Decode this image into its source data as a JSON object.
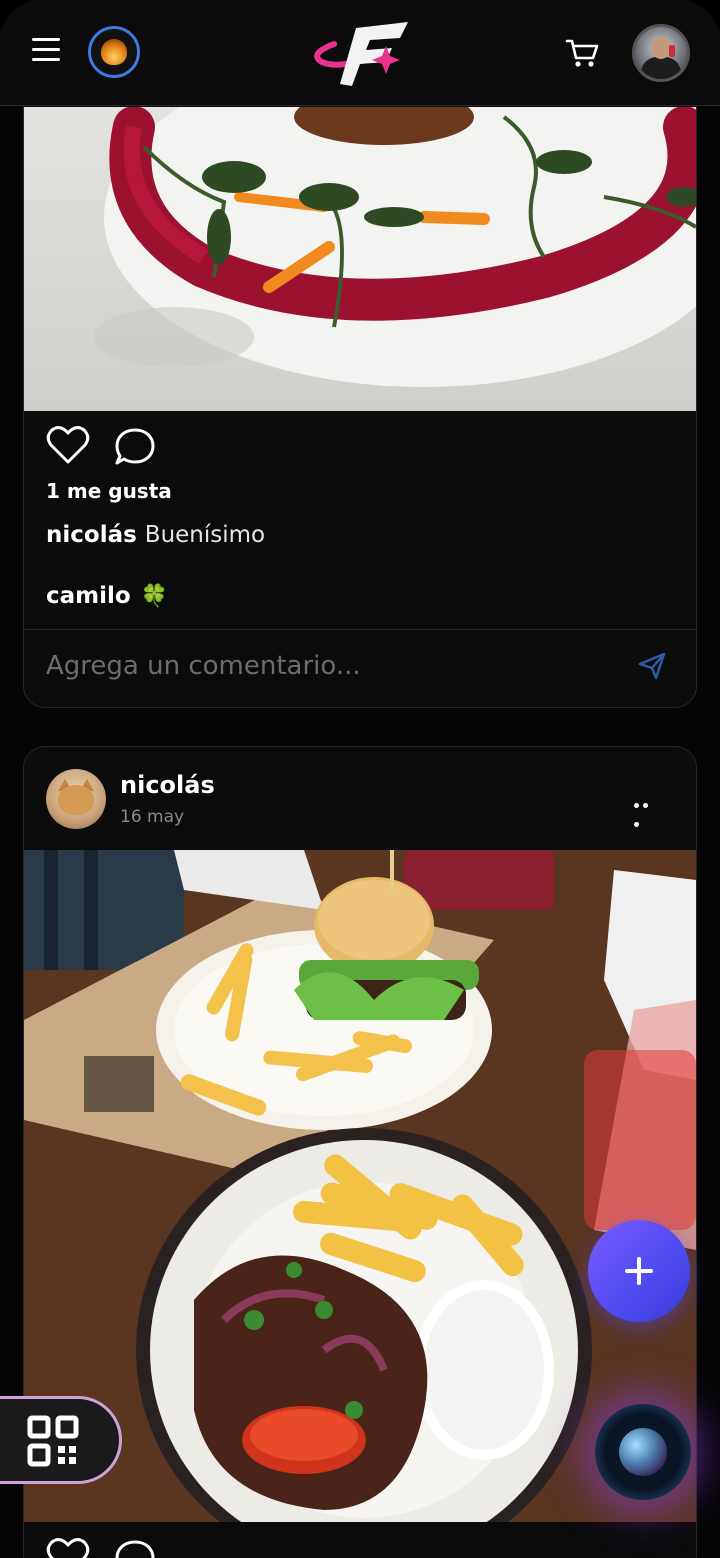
{
  "header": {
    "menu_icon": "hamburger-menu-icon",
    "cart_icon": "shopping-cart-icon",
    "logo_icon": "app-logo"
  },
  "post1": {
    "likes_text": "1 me gusta",
    "comments": [
      {
        "user": "nicolás",
        "text": "Buenísimo"
      },
      {
        "user": "camilo",
        "text": "🍀"
      }
    ],
    "comment_placeholder": "Agrega un comentario...",
    "send_icon": "send-icon"
  },
  "post2": {
    "user": "nicolás",
    "date": "16 may",
    "more_icon": "more-horizontal-icon"
  },
  "floating": {
    "add_icon": "plus-icon",
    "qr_icon": "qr-code-icon",
    "assistant_icon": "assistant-orb-icon"
  },
  "colors": {
    "accent_blue": "#3d7be0",
    "fab_gradient_start": "#7b5cff",
    "fab_gradient_end": "#3a39d8",
    "logo_pink": "#e8338e"
  }
}
